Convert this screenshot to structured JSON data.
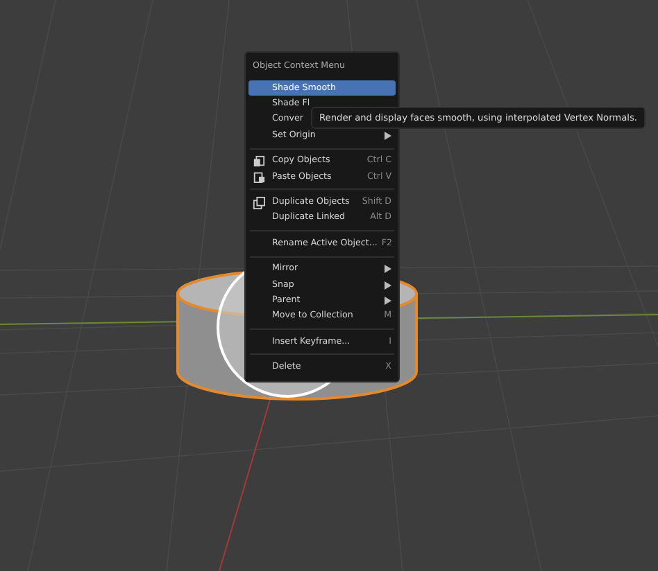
{
  "menu": {
    "title": "Object Context Menu",
    "groups": [
      [
        {
          "label": "Shade Smooth",
          "kind": "plain",
          "selected": true,
          "submenu": false
        },
        {
          "label": "Shade Fl",
          "kind": "plain",
          "selected": false,
          "submenu": false
        },
        {
          "label": "Conver",
          "kind": "plain",
          "selected": false,
          "submenu": false
        },
        {
          "label": "Set Origin",
          "kind": "plain",
          "selected": false,
          "submenu": true
        }
      ],
      [
        {
          "label": "Copy Objects",
          "shortcut": "Ctrl C",
          "kind": "copy",
          "selected": false,
          "submenu": false
        },
        {
          "label": "Paste Objects",
          "shortcut": "Ctrl V",
          "kind": "paste",
          "selected": false,
          "submenu": false
        }
      ],
      [
        {
          "label": "Duplicate Objects",
          "shortcut": "Shift D",
          "kind": "duplicate",
          "selected": false,
          "submenu": false
        },
        {
          "label": "Duplicate Linked",
          "shortcut": "Alt D",
          "kind": "plain",
          "selected": false,
          "submenu": false
        }
      ],
      [
        {
          "label": "Rename Active Object...",
          "shortcut": "F2",
          "kind": "plain",
          "selected": false,
          "submenu": false
        }
      ],
      [
        {
          "label": "Mirror",
          "kind": "plain",
          "selected": false,
          "submenu": true
        },
        {
          "label": "Snap",
          "kind": "plain",
          "selected": false,
          "submenu": true
        },
        {
          "label": "Parent",
          "kind": "plain",
          "selected": false,
          "submenu": true
        },
        {
          "label": "Move to Collection",
          "shortcut": "M",
          "kind": "plain",
          "selected": false,
          "submenu": false
        }
      ],
      [
        {
          "label": "Insert Keyframe...",
          "shortcut": "I",
          "kind": "plain",
          "selected": false,
          "submenu": false
        }
      ],
      [
        {
          "label": "Delete",
          "shortcut": "X",
          "kind": "plain",
          "selected": false,
          "submenu": false
        }
      ]
    ]
  },
  "tooltip": {
    "text": "Render and display faces smooth, using interpolated Vertex Normals."
  }
}
